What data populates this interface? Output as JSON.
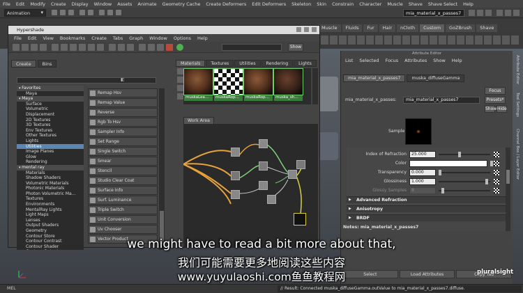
{
  "maya_menu": [
    "File",
    "Edit",
    "Modify",
    "Create",
    "Display",
    "Window",
    "Assets",
    "Animate",
    "Geometry Cache",
    "Create Deformers",
    "Edit Deformers",
    "Skeleton",
    "Skin",
    "Constrain",
    "Character",
    "Muscle",
    "Shave",
    "Shave Select",
    "Help"
  ],
  "status_line": {
    "mode": "Animation",
    "name_field": "mia_material_x_passes7"
  },
  "shelf_tabs": [
    "Muscle",
    "Fluids",
    "Fur",
    "Hair",
    "nCloth",
    "Custom",
    "GoZBrush",
    "Shave"
  ],
  "shelf_active": "Custom",
  "hypershade": {
    "title": "Hypershade",
    "menu": [
      "File",
      "Edit",
      "View",
      "Bookmarks",
      "Create",
      "Tabs",
      "Graph",
      "Window",
      "Options",
      "Help"
    ],
    "show_button": "Show",
    "left_tabs": [
      "Create",
      "Bins"
    ],
    "tree": [
      {
        "label": "Favorites",
        "type": "header"
      },
      {
        "label": "Maya",
        "type": "item"
      },
      {
        "label": "Maya",
        "type": "header"
      },
      {
        "label": "Surface",
        "type": "item"
      },
      {
        "label": "Volumetric",
        "type": "item"
      },
      {
        "label": "Displacement",
        "type": "item"
      },
      {
        "label": "2D Textures",
        "type": "item"
      },
      {
        "label": "3D Textures",
        "type": "item"
      },
      {
        "label": "Env Textures",
        "type": "item"
      },
      {
        "label": "Other Textures",
        "type": "item"
      },
      {
        "label": "Lights",
        "type": "item"
      },
      {
        "label": "Utilities",
        "type": "selected"
      },
      {
        "label": "Image Planes",
        "type": "item"
      },
      {
        "label": "Glow",
        "type": "item"
      },
      {
        "label": "Rendering",
        "type": "item"
      },
      {
        "label": "mental ray",
        "type": "header"
      },
      {
        "label": "Materials",
        "type": "item"
      },
      {
        "label": "Shadow Shaders",
        "type": "item"
      },
      {
        "label": "Volumetric Materials",
        "type": "item"
      },
      {
        "label": "Photonic Materials",
        "type": "item"
      },
      {
        "label": "Photon Volumetric Ma...",
        "type": "item"
      },
      {
        "label": "Textures",
        "type": "item"
      },
      {
        "label": "Environments",
        "type": "item"
      },
      {
        "label": "MentalRay Lights",
        "type": "item"
      },
      {
        "label": "Light Maps",
        "type": "item"
      },
      {
        "label": "Lenses",
        "type": "item"
      },
      {
        "label": "Output Shaders",
        "type": "item"
      },
      {
        "label": "Geometry",
        "type": "item"
      },
      {
        "label": "Contour Store",
        "type": "item"
      },
      {
        "label": "Contour Contrast",
        "type": "item"
      },
      {
        "label": "Contour Shader",
        "type": "item"
      },
      {
        "label": "Contour Output",
        "type": "item"
      }
    ],
    "nodes": [
      "Remap Hsv",
      "Remap Value",
      "Reverse",
      "Rgb To Hsv",
      "Sampler Info",
      "Set Range",
      "Single Switch",
      "Smear",
      "Stencil",
      "Studio Clear Coat",
      "Surface Info",
      "Surf. Luminance",
      "Triple Switch",
      "Unit Conversion",
      "Uv Chooser",
      "Vector Product"
    ],
    "right_tabs": [
      "Materials",
      "Textures",
      "Utilities",
      "Rendering",
      "Lights"
    ],
    "swatches": [
      {
        "label": "muskaLea...",
        "kind": "wood"
      },
      {
        "label": "muskaRop...",
        "kind": "checker"
      },
      {
        "label": "muskaRop...",
        "kind": "wood"
      },
      {
        "label": "muska_sh...",
        "kind": "dark"
      }
    ],
    "work_area_tab": "Work Area"
  },
  "attribute_editor": {
    "title": "Attribute Editor",
    "menu": [
      "List",
      "Selected",
      "Focus",
      "Attributes",
      "Show",
      "Help"
    ],
    "tabs": [
      "mia_material_x_passes7",
      "muska_diffuseGamma"
    ],
    "node_label": "mia_material_x_passes:",
    "node_value": "mia_material_x_passes7",
    "buttons": {
      "focus": "Focus",
      "presets": "Presets*",
      "show": "Show",
      "hide": "Hide"
    },
    "sample_label": "Sample",
    "attrs": [
      {
        "label": "Index of Refraction",
        "value": "25.000",
        "dim": false,
        "knob": 0.4
      },
      {
        "label": "Color",
        "value": "",
        "dim": false,
        "knob": 0.95
      },
      {
        "label": "Transparency",
        "value": "0.000",
        "dim": false,
        "knob": 0.0
      },
      {
        "label": "Glossiness",
        "value": "1.000",
        "dim": false,
        "knob": 0.95
      },
      {
        "label": "Glossy Samples",
        "value": "8",
        "dim": true,
        "knob": 0.05
      }
    ],
    "sections": [
      "Advanced Refraction",
      "Anisotropy",
      "BRDF"
    ],
    "notes": "Notes: mia_material_x_passes7",
    "bottom_buttons": [
      "Select",
      "Load Attributes",
      "Copy Tab"
    ]
  },
  "side_tabs": [
    "Attribute Editor",
    "Tool Settings",
    "Channel Box / Layer Editor"
  ],
  "command_line": {
    "mel": "MEL",
    "result": "// Result: Connected muska_diffuseGamma.outValue to mia_material_x_passes7.diffuse."
  },
  "subtitles": {
    "english": "we might have to read a bit more about that,",
    "chinese": "我们可能需要更多地阅读这些内容",
    "url": "www.yuyulaoshi.com鱼鱼教程网"
  },
  "watermark": "pluralsight",
  "colors": {
    "selection": "#5a86b0",
    "swatch_label": "#3a7d3a",
    "orange_link": "#e8a23a",
    "yellow_link": "#d8d040",
    "green_link": "#7fd07f"
  }
}
